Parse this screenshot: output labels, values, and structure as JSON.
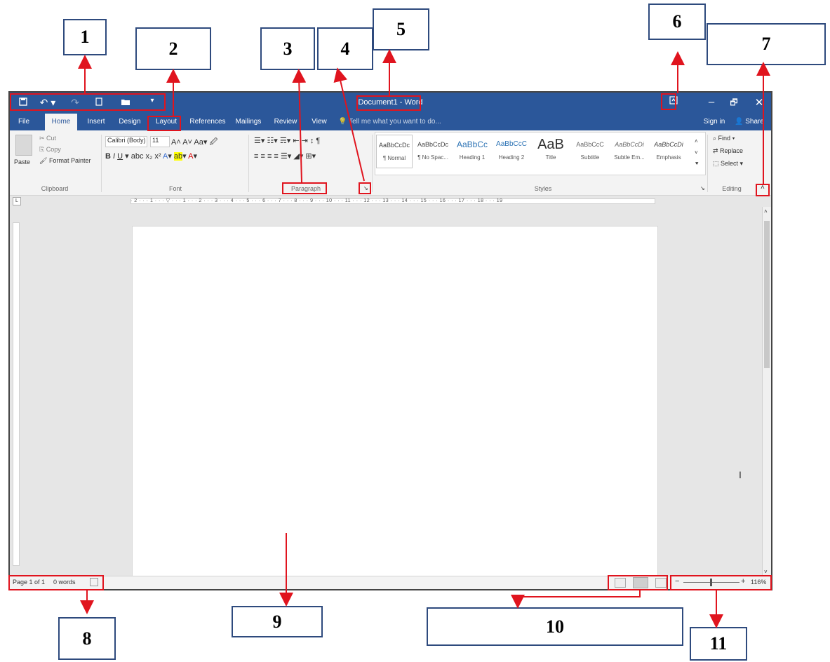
{
  "callouts": [
    "1",
    "2",
    "3",
    "4",
    "5",
    "6",
    "7",
    "8",
    "9",
    "10",
    "11"
  ],
  "titlebar": {
    "title": "Document1 - Word",
    "qat_icons": [
      "save-icon",
      "undo-icon",
      "redo-icon",
      "new-document-icon",
      "open-folder-icon",
      "customize-qat-icon"
    ],
    "restore_ribbon_icon": "ribbon-display-options-icon",
    "minimize": "–",
    "maximize": "🗗",
    "close": "✕"
  },
  "tabs": [
    "File",
    "Home",
    "Insert",
    "Design",
    "Layout",
    "References",
    "Mailings",
    "Review",
    "View"
  ],
  "tell_me": "Tell me what you want to do...",
  "sign_in": "Sign in",
  "share": "Share",
  "clipboard": {
    "paste": "Paste",
    "cut": "Cut",
    "copy": "Copy",
    "format_painter": "Format Painter",
    "label": "Clipboard"
  },
  "font": {
    "name": "Calibri (Body)",
    "size": "11",
    "label": "Font"
  },
  "paragraph": {
    "label": "Paragraph"
  },
  "styles": {
    "label": "Styles",
    "items": [
      {
        "preview": "AaBbCcDc",
        "name": "¶ Normal"
      },
      {
        "preview": "AaBbCcDc",
        "name": "¶ No Spac..."
      },
      {
        "preview": "AaBbCc",
        "name": "Heading 1"
      },
      {
        "preview": "AaBbCcC",
        "name": "Heading 2"
      },
      {
        "preview": "AaB",
        "name": "Title"
      },
      {
        "preview": "AaBbCcC",
        "name": "Subtitle"
      },
      {
        "preview": "AaBbCcDi",
        "name": "Subtle Em..."
      },
      {
        "preview": "AaBbCcDi",
        "name": "Emphasis"
      }
    ]
  },
  "editing": {
    "find": "Find",
    "replace": "Replace",
    "select": "Select",
    "label": "Editing"
  },
  "ruler_numbers": "· 2 · · · 1 · · · ▽ · · · 1 · · · 2 · · · 3 · · · 4 · · · 5 · · · 6 · · · 7 · · · 8 · · · 9 · · · 10 · · · 11 · · · 12 · · · 13 · · · 14 · · · 15 · · · 16 · · · 17 · · · 18 · · · 19",
  "statusbar": {
    "page": "Page 1 of 1",
    "words": "0 words",
    "zoom": "116%"
  }
}
